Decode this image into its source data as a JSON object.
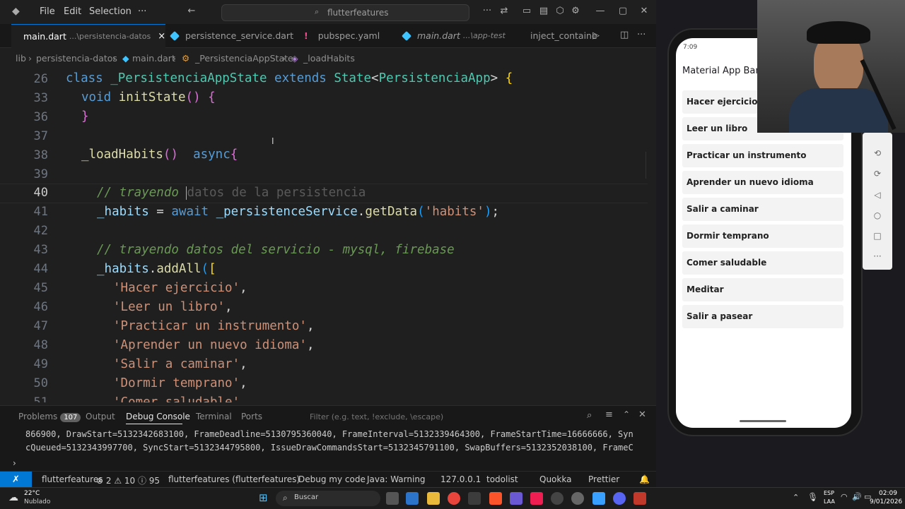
{
  "titlebar": {
    "menu": [
      "File",
      "Edit",
      "Selection",
      "···"
    ],
    "search": "flutterfeatures"
  },
  "tabs": [
    {
      "label": "main.dart",
      "path": "...\\persistencia-datos",
      "active": true,
      "close": "×"
    },
    {
      "label": "persistence_service.dart",
      "path": "",
      "active": false
    },
    {
      "label": "pubspec.yaml",
      "path": "",
      "active": false,
      "icon": "!"
    },
    {
      "label": "main.dart",
      "path": "...\\app-test",
      "active": false,
      "italic": true
    },
    {
      "label": "inject_containe",
      "path": "",
      "active": false
    }
  ],
  "breadcrumb": [
    "lib",
    "persistencia-datos",
    "main.dart",
    "_PersistenciaAppState",
    "_loadHabits"
  ],
  "editor": {
    "line_numbers": [
      "26",
      "33",
      "36",
      "37",
      "38",
      "39",
      "40",
      "41",
      "42",
      "43",
      "44",
      "45",
      "46",
      "47",
      "48",
      "49",
      "50",
      "51"
    ],
    "current_line": "40",
    "ghost_text": "datos de la persistencia"
  },
  "panel": {
    "tabs": [
      "Problems",
      "Output",
      "Debug Console",
      "Terminal",
      "Ports"
    ],
    "problems_count": "107",
    "filter_placeholder": "Filter (e.g. text, !exclude, \\escape)",
    "console_lines": [
      "866900, DrawStart=5132342683100, FrameDeadline=5130795360040, FrameInterval=5132339464300, FrameStartTime=16666666, Syn",
      "cQueued=5132343997700, SyncStart=5132344795800, IssueDrawCommandsStart=5132345791100, SwapBuffers=5132352038100, FrameC"
    ]
  },
  "statusbar": {
    "items": [
      "flutterfeatures",
      "⊗ 2 ⚠ 10 ⓘ 95",
      "flutterfeatures (flutterfeatures)",
      "Debug my code",
      "Java: Warning",
      "127.0.0.1",
      "todolist",
      "Quokka",
      "Prettier"
    ]
  },
  "phone": {
    "time": "7:09",
    "appbar_title": "Material App Bar",
    "habits": [
      "Hacer ejercicio",
      "Leer un libro",
      "Practicar un instrumento",
      "Aprender un nuevo idioma",
      "Salir a caminar",
      "Dormir temprano",
      "Comer saludable",
      "Meditar",
      "Salir a pasear"
    ]
  },
  "taskbar": {
    "weather_temp": "22°C",
    "weather_desc": "Nublado",
    "search": "Buscar",
    "lang": "ESP",
    "lang2": "LAA",
    "time": "02:09",
    "date": "9/01/2026"
  },
  "colors": {
    "accent": "#0078d4",
    "dart": "#40c4ff"
  }
}
